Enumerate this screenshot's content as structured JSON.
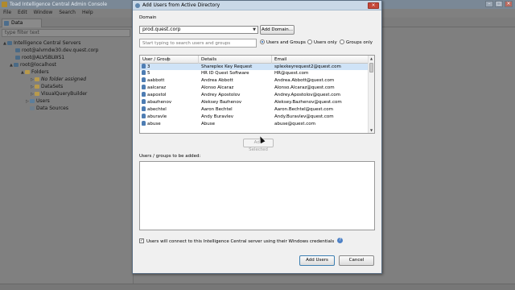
{
  "app": {
    "title": "Toad Intelligence Central Admin Console",
    "menu": [
      "File",
      "Edit",
      "Window",
      "Search",
      "Help"
    ],
    "tab": "Data Explorer",
    "filter_placeholder": "type filter text",
    "tree": [
      {
        "label": "Intelligence Central Servers",
        "icon": "server-group-icon",
        "toggle": "▲"
      },
      {
        "label": "root@alvmdw30.dev.quest.corp",
        "icon": "server-icon",
        "toggle": ""
      },
      {
        "label": "root@ALVSBLWS1",
        "icon": "server-icon",
        "toggle": ""
      },
      {
        "label": "root@localhost",
        "icon": "server-icon",
        "toggle": "▲"
      },
      {
        "label": "Folders",
        "icon": "folder-icon",
        "toggle": "▲"
      },
      {
        "label": "No folder assigned",
        "icon": "folder-icon",
        "toggle": "▷"
      },
      {
        "label": "DataSets",
        "icon": "folder-icon",
        "toggle": "▷"
      },
      {
        "label": "VisualQueryBuilder",
        "icon": "folder-icon",
        "toggle": "▷"
      },
      {
        "label": "Users",
        "icon": "users-icon",
        "toggle": "▷"
      },
      {
        "label": "Data Sources",
        "icon": "data-source-icon",
        "toggle": ""
      }
    ]
  },
  "dialog": {
    "title": "Add Users from Active Directory",
    "domain_label": "Domain",
    "domain_value": "prod.quest.corp",
    "add_domain_label": "Add Domain...",
    "search_placeholder": "Start typing to search users and groups",
    "filter_options": [
      {
        "label": "Users and Groups",
        "selected": true
      },
      {
        "label": "Users only",
        "selected": false
      },
      {
        "label": "Groups only",
        "selected": false
      }
    ],
    "columns": [
      "User / Group",
      "Details",
      "Email"
    ],
    "rows": [
      {
        "user": "3",
        "details": "Shareplex Key Request",
        "email": "splexkeyrequest2@quest.com"
      },
      {
        "user": "5",
        "details": "HR ID Quest Software",
        "email": "HR@quest.com"
      },
      {
        "user": "aabbott",
        "details": "Andrea Abbott",
        "email": "Andrea.Abbott@quest.com"
      },
      {
        "user": "aalcaraz",
        "details": "Alonso Alcaraz",
        "email": "Alonso.Alcaraz@quest.com"
      },
      {
        "user": "aapostol",
        "details": "Andrey Apostolov",
        "email": "Andrey.Apostolov@quest.com"
      },
      {
        "user": "abazhenov",
        "details": "Aleksey Bazhenov",
        "email": "Aleksey.Bazhenov@quest.com"
      },
      {
        "user": "abechtel",
        "details": "Aaron Bechtel",
        "email": "Aaron.Bechtel@quest.com"
      },
      {
        "user": "aburavle",
        "details": "Andy Buravlev",
        "email": "Andy.Buravlev@quest.com"
      },
      {
        "user": "abuse",
        "details": "Abuse",
        "email": "abuse@quest.com"
      }
    ],
    "add_selected_label": "Add Selected",
    "to_be_added_label": "Users / groups to be added:",
    "windows_checkbox_label": "Users will connect to this Intelligence Central server using their Windows credentials",
    "windows_checkbox_checked": true,
    "add_users_label": "Add Users",
    "cancel_label": "Cancel"
  }
}
